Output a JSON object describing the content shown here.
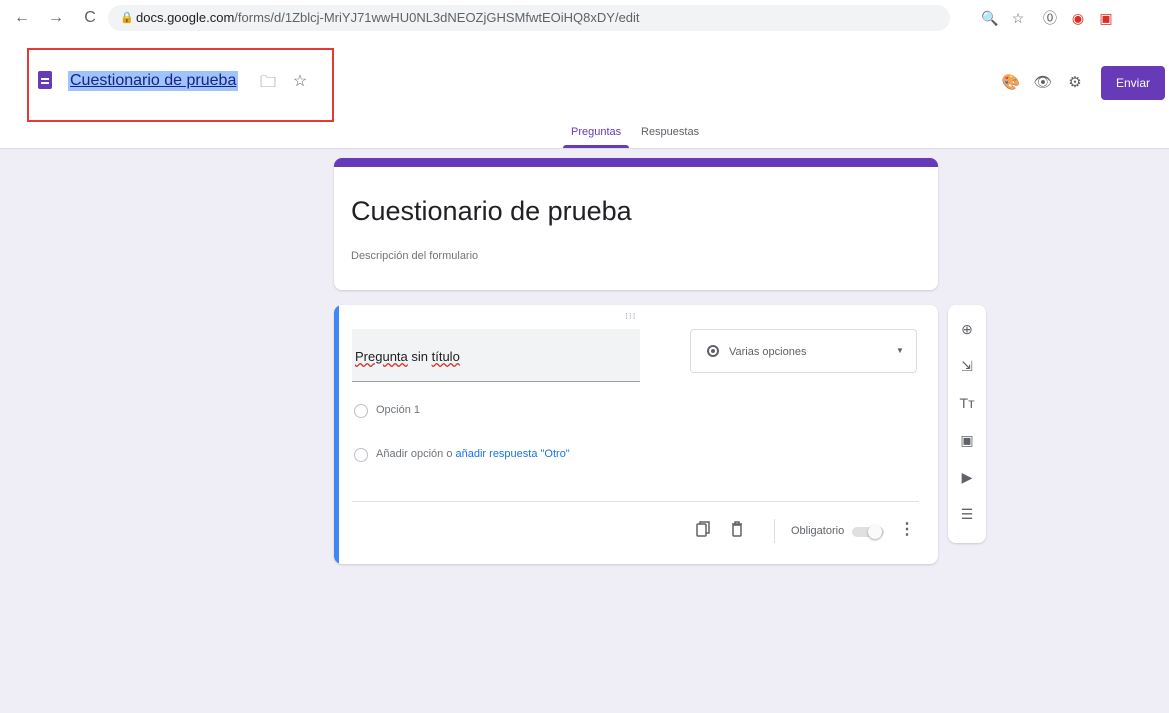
{
  "browser": {
    "back_icon": "←",
    "forward_icon": "→",
    "reload_icon": "C",
    "lock_icon": "🔒",
    "url_host": "docs.google.com",
    "url_path": "/forms/d/1Zblcj-MriYJ71wwHU0NL3dNEOZjGHSMfwtEOiHQ8xDY/edit",
    "extension_icons": [
      "🔍",
      "☆",
      "⓪",
      "◉",
      "▣"
    ]
  },
  "header": {
    "doc_title": "Cuestionario de prueba",
    "folder_icon": "🗀",
    "star_icon": "☆",
    "palette_icon": "🎨",
    "preview_icon": "👁",
    "settings_icon": "⚙",
    "send_label": "Enviar"
  },
  "tabs": [
    {
      "label": "Preguntas",
      "active": true
    },
    {
      "label": "Respuestas",
      "active": false
    }
  ],
  "form": {
    "title": "Cuestionario de prueba",
    "description_placeholder": "Descripción del formulario"
  },
  "question": {
    "drag_handle": "⁝⁝⁝",
    "title_word1": "Pregunta",
    "title_word2": " sin ",
    "title_word3": "título",
    "type_label": "Varias opciones",
    "type_arrow": "▼",
    "option1": "Opción 1",
    "add_option": "Añadir opción",
    "or_text": " o ",
    "add_other": "añadir respuesta \"Otro\"",
    "required_label": "Obligatorio",
    "more_icon": "⋮"
  },
  "side_toolbar_icons": [
    "⊕",
    "⇲",
    "Tт",
    "▣",
    "▶",
    "☰"
  ],
  "colors": {
    "accent": "#673ab7",
    "question_bar": "#4285f4",
    "background": "#efedf5",
    "highlight_box": "#e53935"
  }
}
